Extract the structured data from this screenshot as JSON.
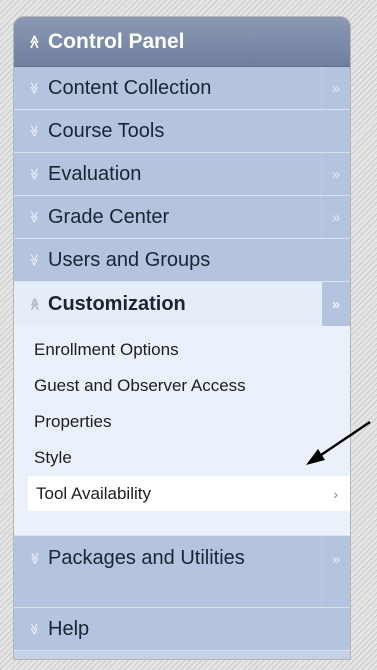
{
  "panel": {
    "title": "Control Panel",
    "items": [
      {
        "label": "Content Collection",
        "has_arrow": true
      },
      {
        "label": "Course Tools",
        "has_arrow": false
      },
      {
        "label": "Evaluation",
        "has_arrow": true
      },
      {
        "label": "Grade Center",
        "has_arrow": true
      },
      {
        "label": "Users and Groups",
        "has_arrow": false
      },
      {
        "label": "Customization",
        "has_arrow": true,
        "expanded": true
      },
      {
        "label": "Packages and Utilities",
        "has_arrow": true
      },
      {
        "label": "Help",
        "has_arrow": false
      }
    ],
    "customization_subitems": [
      "Enrollment Options",
      "Guest and Observer Access",
      "Properties",
      "Style",
      "Tool Availability"
    ],
    "icons": {
      "collapse": "double-chevron-up-icon",
      "expand": "double-chevron-down-icon",
      "flyout": "double-chevron-right-icon",
      "item_arrow": "chevron-right-icon"
    },
    "glyphs": {
      "collapse": "≫",
      "expand": "≫",
      "flyout": "»",
      "item_arrow": "›"
    }
  },
  "colors": {
    "header": "#7b8aa8",
    "item_bg": "#b4c4de",
    "expanded_bg": "#e5edf8",
    "annotation_arrow": "#000000"
  }
}
